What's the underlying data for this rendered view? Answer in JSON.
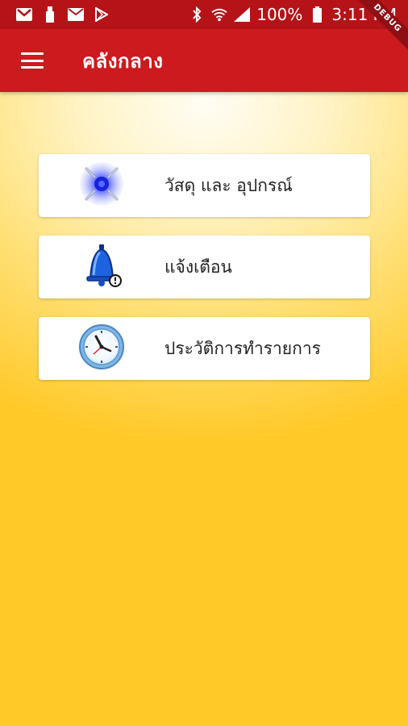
{
  "status_bar": {
    "battery": "100%",
    "time": "3:11 PM",
    "icons": [
      "gmail-icon",
      "usb-icon",
      "mail-icon",
      "play-store-icon",
      "bluetooth-icon",
      "wifi-icon",
      "signal-icon",
      "battery-icon"
    ]
  },
  "app_bar": {
    "title": "คลังกลาง",
    "menu_icon": "hamburger-menu-icon",
    "debug_banner": "DEBUG"
  },
  "menu": {
    "items": [
      {
        "label": "วัสดุ และ อุปกรณ์",
        "icon": "materials-icon"
      },
      {
        "label": "แจ้งเตือน",
        "icon": "bell-alert-icon"
      },
      {
        "label": "ประวัติการทำรายการ",
        "icon": "clock-icon"
      }
    ]
  },
  "colors": {
    "status_bar": "#b51318",
    "app_bar": "#cc1a1f",
    "bg_top": "#fffdf4",
    "bg_bottom": "#ffc928"
  }
}
